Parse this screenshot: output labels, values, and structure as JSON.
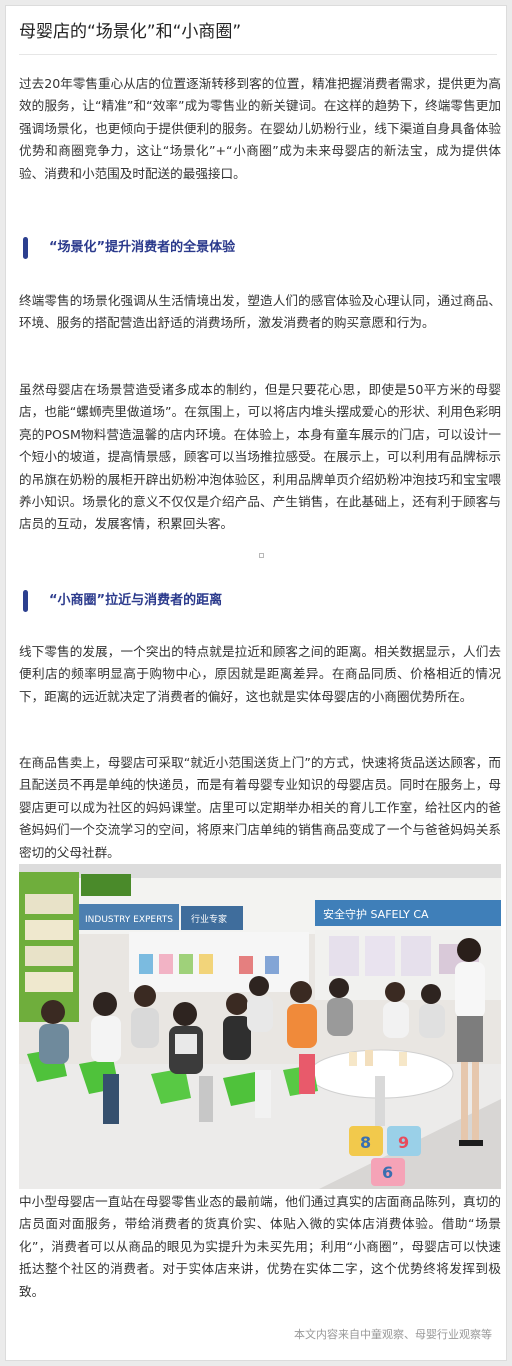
{
  "article": {
    "title": "母婴店的“场景化”和“小商圈”",
    "intro": "过去20年零售重心从店的位置逐渐转移到客的位置，精准把握消费者需求，提供更为高效的服务，让“精准”和“效率”成为零售业的新关键词。在这样的趋势下，终端零售更加强调场景化，也更倾向于提供便利的服务。在婴幼儿奶粉行业，线下渠道自身具备体验优势和商圈竞争力，这让“场景化”+“小商圈”成为未来母婴店的新法宝，成为提供体验、消费和小范围及时配送的最强接口。",
    "section1": {
      "heading": "“场景化”提升消费者的全景体验",
      "p1": "终端零售的场景化强调从生活情境出发，塑造人们的感官体验及心理认同，通过商品、环境、服务的搭配营造出舒适的消费场所，激发消费者的购买意愿和行为。",
      "p2": "虽然母婴店在场景营造受诸多成本的制约，但是只要花心思，即使是50平方米的母婴店，也能“螺蛳壳里做道场”。在氛围上，可以将店内堆头摆成爱心的形状、利用色彩明亮的POSM物料营造温馨的店内环境。在体验上，本身有童车展示的门店，可以设计一个短小的坡道，提高情景感，顾客可以当场推拉感受。在展示上，可以利用有品牌标示的吊旗在奶粉的展柜开辟出奶粉冲泡体验区，利用品牌单页介绍奶粉冲泡技巧和宝宝喂养小知识。场景化的意义不仅仅是介绍产品、产生销售，在此基础上，还有利于顾客与店员的互动，发展客情，积累回头客。"
    },
    "section2": {
      "heading": "“小商圈”拉近与消费者的距离",
      "p1": "线下零售的发展，一个突出的特点就是拉近和顾客之间的距离。相关数据显示，人们去便利店的频率明显高于购物中心，原因就是距离差异。在商品同质、价格相近的情况下，距离的远近就决定了消费者的偏好，这也就是实体母婴店的小商圈优势所在。",
      "p2": "在商品售卖上，母婴店可采取“就近小范围送货上门”的方式，快速将货品送达顾客，而且配送员不再是单纯的快递员，而是有着母婴专业知识的母婴店员。同时在服务上，母婴店更可以成为社区的妈妈课堂。店里可以定期举办相关的育儿工作室，给社区内的爸爸妈妈们一个交流学习的空间，将原来门店单纯的销售商品变成了一个与爸爸妈妈关系密切的父母社群。",
      "p3": "中小型母婴店一直站在母婴零售业态的最前端，他们通过真实的店面商品陈列，真切的店员面对面服务，带给消费者的货真价实、体贴入微的实体店消费体验。借助“场景化”，消费者可以从商品的眼见为实提升为未买先用；利用“小商圈”，母婴店可以快速抵达整个社区的消费者。对于实体店来讲，优势在实体二字，这个优势终将发挥到极致。"
    },
    "photo": {
      "sign_left": "INDUSTRY EXPERTS",
      "sign_left_cn": "行业专家",
      "sign_right": "安全守护 SAFELY CA",
      "floor_numbers": [
        "8",
        "9",
        "6"
      ]
    },
    "source": "本文内容来自中童观察、母婴行业观察等"
  },
  "colors": {
    "heading_accent": "#2c3f8f",
    "heading_text": "#2b3a8c",
    "body_text": "#333333",
    "source_text": "#999999"
  }
}
